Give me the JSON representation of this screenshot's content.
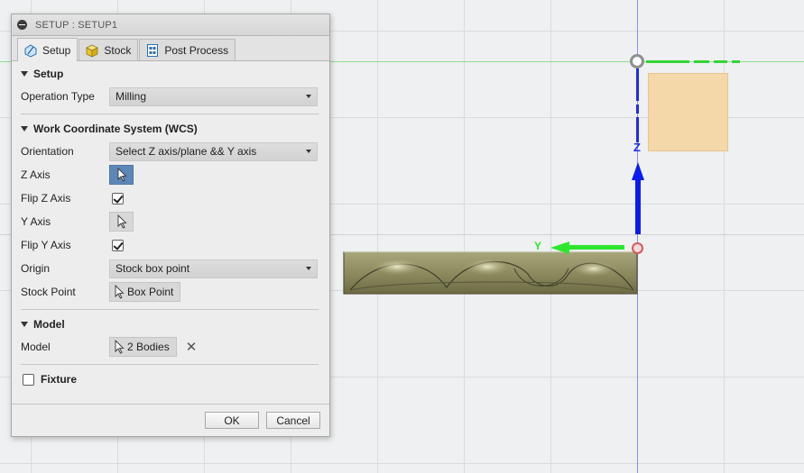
{
  "dialog": {
    "title": "SETUP : SETUP1",
    "tabs": [
      {
        "label": "Setup",
        "icon": "setup-icon",
        "active": true
      },
      {
        "label": "Stock",
        "icon": "stock-cube-icon",
        "active": false
      },
      {
        "label": "Post Process",
        "icon": "post-process-icon",
        "active": false
      }
    ],
    "setup": {
      "header": "Setup",
      "operation_type_label": "Operation Type",
      "operation_type_value": "Milling"
    },
    "wcs": {
      "header": "Work Coordinate System (WCS)",
      "orientation_label": "Orientation",
      "orientation_value": "Select Z axis/plane && Y axis",
      "z_axis_label": "Z Axis",
      "flip_z_label": "Flip Z Axis",
      "flip_z_checked": true,
      "y_axis_label": "Y Axis",
      "flip_y_label": "Flip Y Axis",
      "flip_y_checked": true,
      "origin_label": "Origin",
      "origin_value": "Stock box point",
      "stock_point_label": "Stock Point",
      "stock_point_value": "Box Point"
    },
    "model": {
      "header": "Model",
      "model_label": "Model",
      "model_value": "2 Bodies"
    },
    "fixture": {
      "label": "Fixture",
      "checked": false
    },
    "buttons": {
      "ok": "OK",
      "cancel": "Cancel"
    }
  },
  "viewport": {
    "z_axis_label": "Z",
    "y_axis_label": "Y",
    "colors": {
      "z_axis": "#0b1cf0",
      "y_axis": "#2ee62e",
      "stock_box": "#f5d7a6",
      "selection_active": "#5d87b8"
    }
  }
}
